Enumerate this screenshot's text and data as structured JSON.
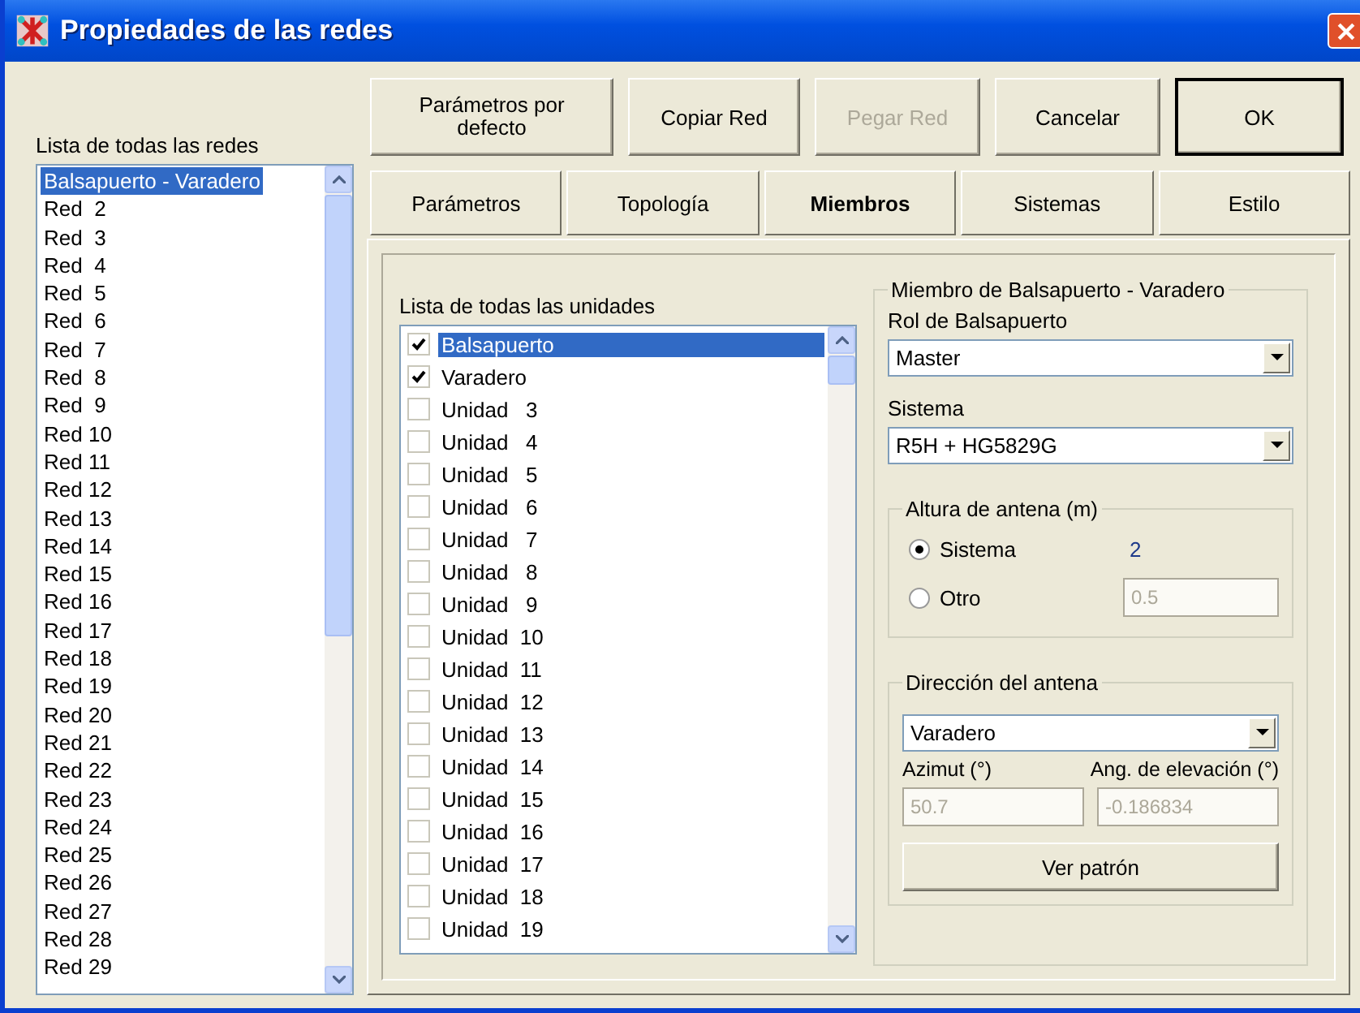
{
  "window": {
    "title": "Propiedades de las redes"
  },
  "networks": {
    "label": "Lista de todas las redes",
    "items": [
      {
        "label": "Balsapuerto - Varadero",
        "selected": true
      },
      {
        "label": "Red  2",
        "selected": false
      },
      {
        "label": "Red  3",
        "selected": false
      },
      {
        "label": "Red  4",
        "selected": false
      },
      {
        "label": "Red  5",
        "selected": false
      },
      {
        "label": "Red  6",
        "selected": false
      },
      {
        "label": "Red  7",
        "selected": false
      },
      {
        "label": "Red  8",
        "selected": false
      },
      {
        "label": "Red  9",
        "selected": false
      },
      {
        "label": "Red 10",
        "selected": false
      },
      {
        "label": "Red 11",
        "selected": false
      },
      {
        "label": "Red 12",
        "selected": false
      },
      {
        "label": "Red 13",
        "selected": false
      },
      {
        "label": "Red 14",
        "selected": false
      },
      {
        "label": "Red 15",
        "selected": false
      },
      {
        "label": "Red 16",
        "selected": false
      },
      {
        "label": "Red 17",
        "selected": false
      },
      {
        "label": "Red 18",
        "selected": false
      },
      {
        "label": "Red 19",
        "selected": false
      },
      {
        "label": "Red 20",
        "selected": false
      },
      {
        "label": "Red 21",
        "selected": false
      },
      {
        "label": "Red 22",
        "selected": false
      },
      {
        "label": "Red 23",
        "selected": false
      },
      {
        "label": "Red 24",
        "selected": false
      },
      {
        "label": "Red 25",
        "selected": false
      },
      {
        "label": "Red 26",
        "selected": false
      },
      {
        "label": "Red 27",
        "selected": false
      },
      {
        "label": "Red 28",
        "selected": false
      },
      {
        "label": "Red 29",
        "selected": false
      }
    ]
  },
  "buttons": [
    {
      "label": "Parámetros por defecto",
      "disabled": false,
      "default": false
    },
    {
      "label": "Copiar Red",
      "disabled": false,
      "default": false
    },
    {
      "label": "Pegar Red",
      "disabled": true,
      "default": false
    },
    {
      "label": "Cancelar",
      "disabled": false,
      "default": false
    },
    {
      "label": "OK",
      "disabled": false,
      "default": true
    }
  ],
  "tabs": [
    {
      "label": "Parámetros",
      "selected": false
    },
    {
      "label": "Topología",
      "selected": false
    },
    {
      "label": "Miembros",
      "selected": true
    },
    {
      "label": "Sistemas",
      "selected": false
    },
    {
      "label": "Estilo",
      "selected": false
    }
  ],
  "units": {
    "label": "Lista de todas las unidades",
    "items": [
      {
        "label": "Balsapuerto",
        "checked": true,
        "selected": true
      },
      {
        "label": "Varadero",
        "checked": true,
        "selected": false
      },
      {
        "label": "Unidad   3",
        "checked": false,
        "selected": false
      },
      {
        "label": "Unidad   4",
        "checked": false,
        "selected": false
      },
      {
        "label": "Unidad   5",
        "checked": false,
        "selected": false
      },
      {
        "label": "Unidad   6",
        "checked": false,
        "selected": false
      },
      {
        "label": "Unidad   7",
        "checked": false,
        "selected": false
      },
      {
        "label": "Unidad   8",
        "checked": false,
        "selected": false
      },
      {
        "label": "Unidad   9",
        "checked": false,
        "selected": false
      },
      {
        "label": "Unidad  10",
        "checked": false,
        "selected": false
      },
      {
        "label": "Unidad  11",
        "checked": false,
        "selected": false
      },
      {
        "label": "Unidad  12",
        "checked": false,
        "selected": false
      },
      {
        "label": "Unidad  13",
        "checked": false,
        "selected": false
      },
      {
        "label": "Unidad  14",
        "checked": false,
        "selected": false
      },
      {
        "label": "Unidad  15",
        "checked": false,
        "selected": false
      },
      {
        "label": "Unidad  16",
        "checked": false,
        "selected": false
      },
      {
        "label": "Unidad  17",
        "checked": false,
        "selected": false
      },
      {
        "label": "Unidad  18",
        "checked": false,
        "selected": false
      },
      {
        "label": "Unidad  19",
        "checked": false,
        "selected": false
      }
    ]
  },
  "member": {
    "title": "Miembro de Balsapuerto - Varadero",
    "role_label": "Rol de Balsapuerto",
    "role_value": "Master",
    "system_label": "Sistema",
    "system_value": "R5H + HG5829G",
    "height": {
      "title": "Altura de antena (m)",
      "options": [
        {
          "label": "Sistema",
          "selected": true
        },
        {
          "label": "Otro",
          "selected": false
        }
      ],
      "system_value": "2",
      "other_value": "0.5",
      "other_disabled": true
    },
    "direction": {
      "title": "Dirección del antena",
      "value": "Varadero",
      "azimuth_label": "Azimut (°)",
      "azimuth_value": "50.7",
      "elevation_label": "Ang. de elevación (°)",
      "elevation_value": "-0.186834",
      "fields_disabled": true,
      "button": "Ver patrón"
    }
  }
}
